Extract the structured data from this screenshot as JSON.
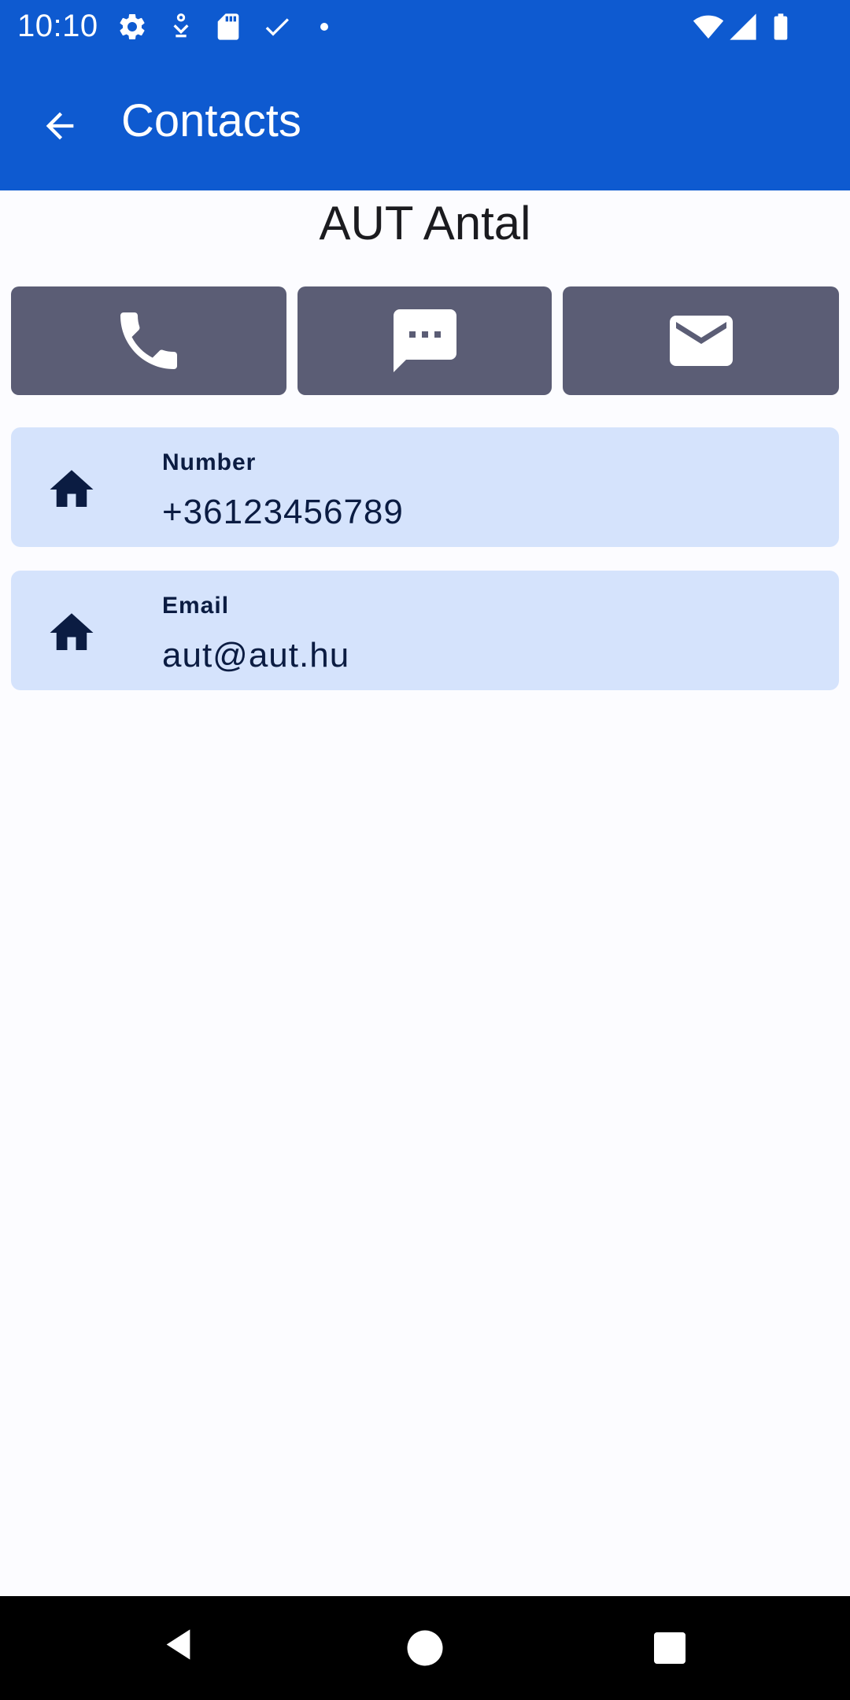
{
  "status_bar": {
    "time": "10:10",
    "left_icons": [
      "settings-icon",
      "accessibility-icon",
      "sd-card-icon",
      "check-icon",
      "dot-icon"
    ],
    "right_icons": [
      "wifi-icon",
      "signal-icon",
      "battery-icon"
    ]
  },
  "app_bar": {
    "title": "Contacts",
    "back_icon": "arrow-back-icon"
  },
  "contact": {
    "name": "AUT Antal"
  },
  "actions": [
    {
      "name": "call",
      "icon": "phone-icon"
    },
    {
      "name": "message",
      "icon": "message-icon"
    },
    {
      "name": "email",
      "icon": "mail-icon"
    }
  ],
  "details": [
    {
      "label": "Number",
      "value": "+36123456789",
      "icon": "home-icon"
    },
    {
      "label": "Email",
      "value": "aut@aut.hu",
      "icon": "home-icon"
    }
  ],
  "navigation": [
    "back-icon",
    "home-circle-icon",
    "recents-icon"
  ],
  "colors": {
    "primary": "#0e5ad0",
    "action_button": "#5b5d75",
    "card_background": "#d5e3fc",
    "card_text": "#0b1c42",
    "background": "#fcfcff"
  }
}
